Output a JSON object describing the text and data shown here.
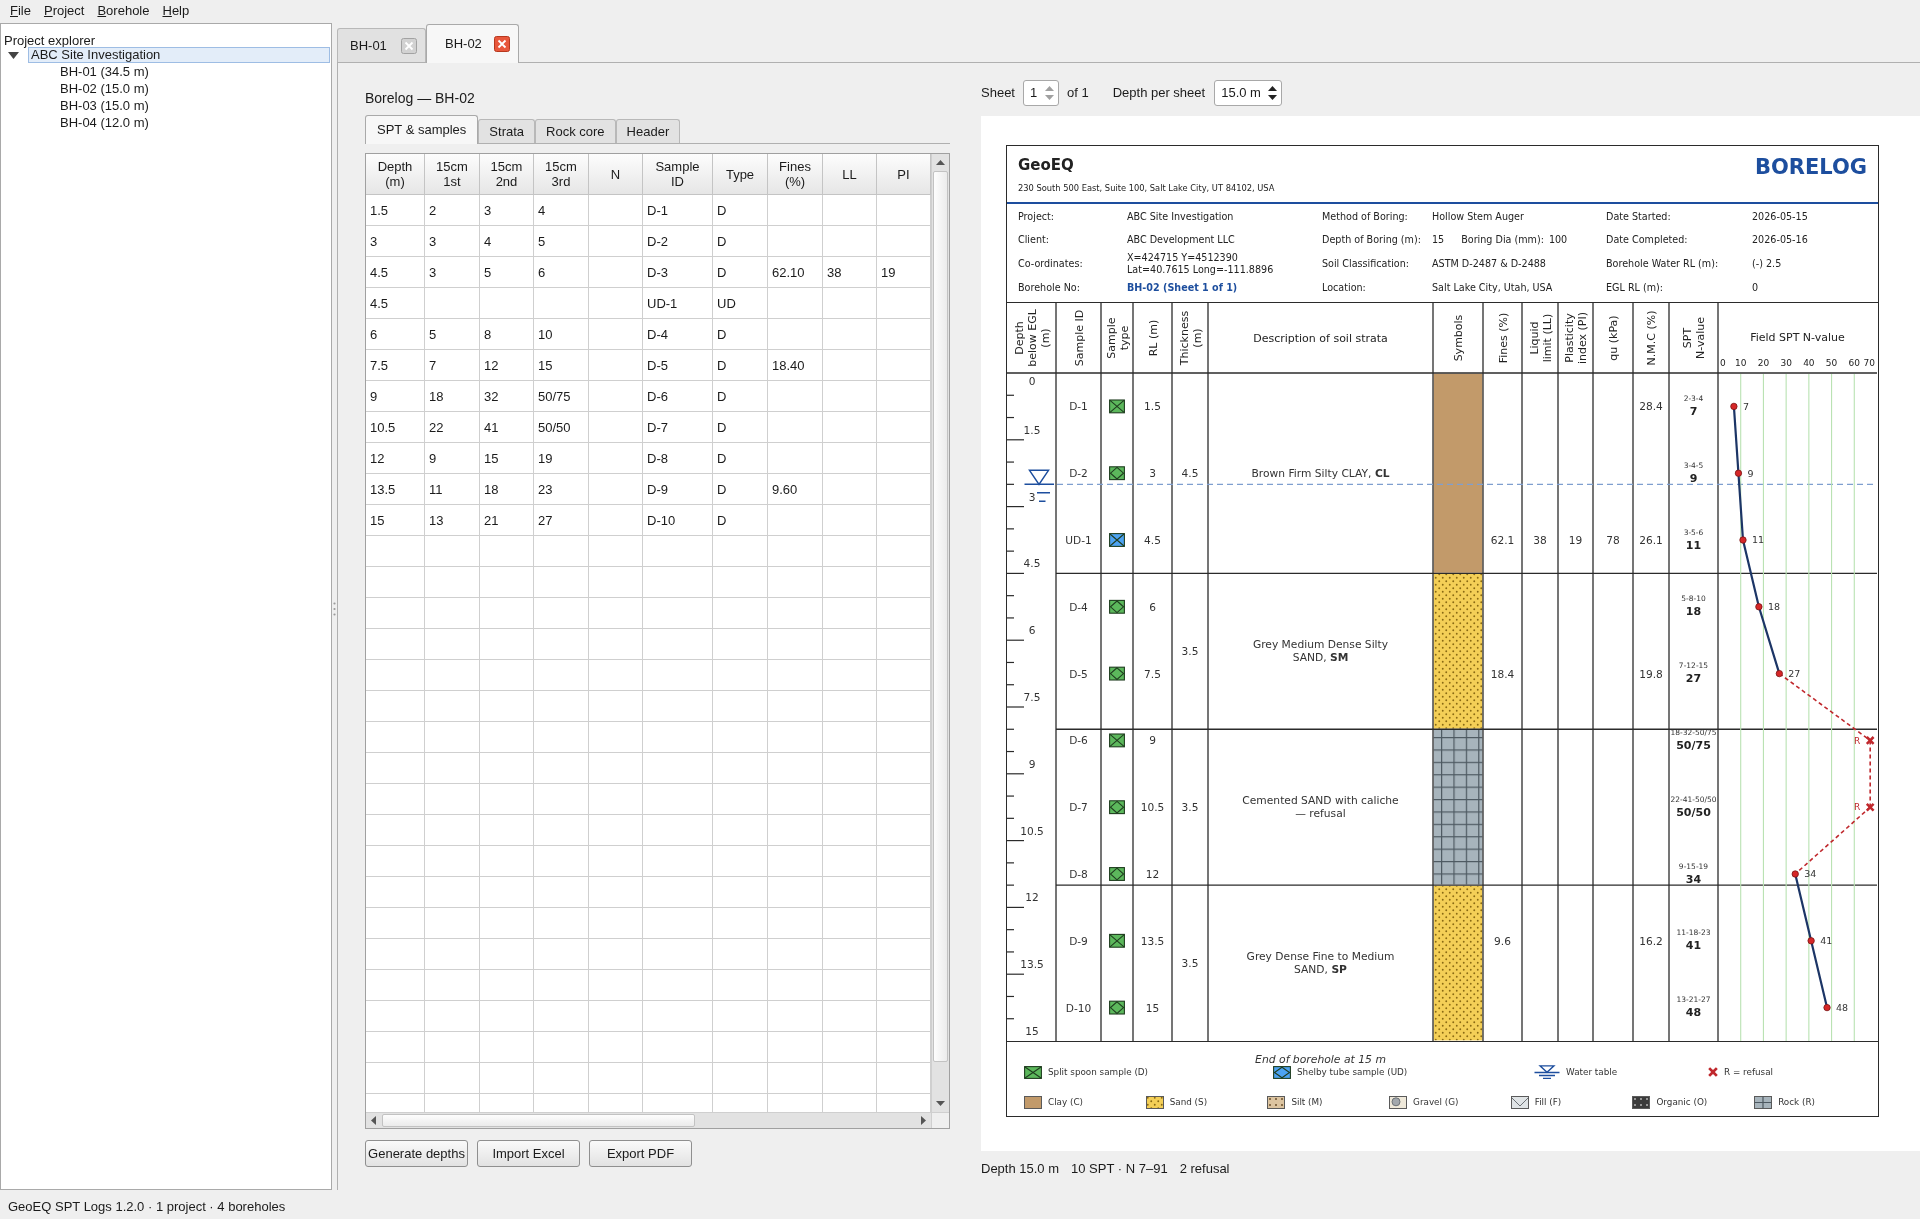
{
  "menu": [
    {
      "label": "File"
    },
    {
      "label": "Project"
    },
    {
      "label": "Borehole"
    },
    {
      "label": "Help"
    }
  ],
  "explorer": {
    "title": "Project explorer",
    "tree": [
      {
        "label": "ABC Site Investigation",
        "expanded": true,
        "selected": true,
        "children": [
          {
            "label": "BH-01 (34.5 m)",
            "selected": false
          },
          {
            "label": "BH-02 (15.0 m)",
            "selected": false
          },
          {
            "label": "BH-03 (15.0 m)",
            "selected": false
          },
          {
            "label": "BH-04 (12.0 m)",
            "selected": false
          }
        ]
      }
    ]
  },
  "doc_tabs": [
    {
      "label": "BH-01",
      "selected": false
    },
    {
      "label": "BH-02",
      "selected": true
    }
  ],
  "editor": {
    "title": "Borelog — BH-02",
    "tabs": [
      {
        "label": "SPT & samples",
        "selected": true
      },
      {
        "label": "Strata",
        "selected": false
      },
      {
        "label": "Rock core",
        "selected": false
      },
      {
        "label": "Header",
        "selected": false
      }
    ],
    "table": {
      "columns": [
        "Depth (m)",
        "15cm 1st",
        "15cm 2nd",
        "15cm 3rd",
        "N",
        "Sample ID",
        "Type",
        "Fines (%)",
        "LL",
        "PI"
      ],
      "rows": [
        [
          "1.5",
          "2",
          "3",
          "4",
          null,
          "D-1",
          "D",
          null,
          null,
          null
        ],
        [
          "3",
          "3",
          "4",
          "5",
          null,
          "D-2",
          "D",
          null,
          null,
          null
        ],
        [
          "4.5",
          "3",
          "5",
          "6",
          null,
          "D-3",
          "D",
          "62.10",
          "38",
          "19"
        ],
        [
          "4.5",
          null,
          null,
          null,
          null,
          "UD-1",
          "UD",
          null,
          null,
          null
        ],
        [
          "6",
          "5",
          "8",
          "10",
          null,
          "D-4",
          "D",
          null,
          null,
          null
        ],
        [
          "7.5",
          "7",
          "12",
          "15",
          null,
          "D-5",
          "D",
          "18.40",
          null,
          null
        ],
        [
          "9",
          "18",
          "32",
          "50/75",
          null,
          "D-6",
          "D",
          null,
          null,
          null
        ],
        [
          "10.5",
          "22",
          "41",
          "50/50",
          null,
          "D-7",
          "D",
          null,
          null,
          null
        ],
        [
          "12",
          "9",
          "15",
          "19",
          null,
          "D-8",
          "D",
          null,
          null,
          null
        ],
        [
          "13.5",
          "11",
          "18",
          "23",
          null,
          "D-9",
          "D",
          "9.60",
          null,
          null
        ],
        [
          "15",
          "13",
          "21",
          "27",
          null,
          "D-10",
          "D",
          null,
          null,
          null
        ]
      ]
    },
    "buttons": [
      {
        "label": "Generate depths"
      },
      {
        "label": "Import Excel"
      },
      {
        "label": "Export PDF"
      }
    ]
  },
  "preview": {
    "sheet": {
      "label": "Sheet",
      "value": "1",
      "suffix": "of 1",
      "steppers_enabled": false
    },
    "depth_per_sheet": {
      "label": "Depth per sheet",
      "value": "15.0 m",
      "steppers_enabled": true
    },
    "borelog": {
      "company": "GeoEQ",
      "address": "230 South 500 East, Suite 100, Salt Lake City, UT 84102, USA",
      "title": "BORELOG",
      "info": [
        {
          "label": "Project:",
          "value": "ABC Site Investigation",
          "kind": "plain"
        },
        {
          "label": "Method of Boring:",
          "value": "Hollow Stem Auger",
          "kind": "plain"
        },
        {
          "label": "Date Started:",
          "value": "2026-05-15",
          "kind": "plain"
        },
        {
          "label": "Client:",
          "value": "ABC Development LLC",
          "kind": "plain"
        },
        {
          "label": "Depth of Boring (m):",
          "value": "15",
          "kind": "plain",
          "extra_label": "Boring Dia (mm):",
          "extra_value": "100"
        },
        {
          "label": "Date Completed:",
          "value": "2026-05-16",
          "kind": "plain"
        },
        {
          "label": "Co-ordinates:",
          "value": "X=424715 Y=4512390\nLat=40.7615 Long=-111.8896",
          "kind": "plain"
        },
        {
          "label": "Soil Classification:",
          "value": "ASTM D-2487 & D-2488",
          "kind": "plain"
        },
        {
          "label": "Borehole Water RL (m):",
          "value": "(-) 2.5",
          "kind": "water"
        },
        {
          "label": "Borehole No:",
          "value": "BH-02 (Sheet 1 of 1)",
          "kind": "link"
        },
        {
          "label": "Location:",
          "value": "Salt Lake City, Utah, USA",
          "kind": "plain"
        },
        {
          "label": "EGL RL (m):",
          "value": "0",
          "kind": "plain"
        }
      ],
      "columns": [
        {
          "label": "Depth\nbelow EGL\n(m)",
          "kind": "rotated"
        },
        {
          "label": "Sample ID",
          "kind": "rotated"
        },
        {
          "label": "Sample\ntype",
          "kind": "rotated"
        },
        {
          "label": "RL (m)",
          "kind": "rotated"
        },
        {
          "label": "Thickness\n(m)",
          "kind": "rotated"
        },
        {
          "label": "Description of soil strata",
          "kind": "flat"
        },
        {
          "label": "Symbols",
          "kind": "rotated"
        },
        {
          "label": "Fines (%)",
          "kind": "rotated"
        },
        {
          "label": "Liquid\nlimit (LL)",
          "kind": "rotated"
        },
        {
          "label": "Plasticity\nindex (PI)",
          "kind": "rotated"
        },
        {
          "label": "qu (kPa)",
          "kind": "rotated"
        },
        {
          "label": "N.M.C (%)",
          "kind": "rotated"
        },
        {
          "label": "SPT\nN-value",
          "kind": "rotated"
        }
      ],
      "depth_labels": [
        "0",
        "1.5",
        "3",
        "4.5",
        "6",
        "7.5",
        "9",
        "10.5",
        "12",
        "13.5",
        "15"
      ],
      "layers": [
        {
          "description": "Brown Firm Silty CLAY, **CL**",
          "thickness": "4.5",
          "kind": "clay"
        },
        {
          "description": "Grey Medium Dense Silty SAND, **SM**",
          "thickness": "3.5",
          "kind": "sand"
        },
        {
          "description": "Cemented SAND with caliche — refusal",
          "thickness": "3.5",
          "kind": "rock"
        },
        {
          "description": "Grey Dense Fine to Medium SAND, **SP**",
          "thickness": "3.5",
          "kind": "sand"
        }
      ],
      "samples": [
        {
          "id": "D-1",
          "kind": "cross",
          "color": "#5cb85c",
          "rl": "1.5",
          "nmc": "28.4",
          "blows": "2-3-4",
          "n": "7"
        },
        {
          "id": "D-2",
          "kind": "diamond",
          "color": "#5cb85c",
          "rl": "3",
          "blows": "3-4-5",
          "n": "9"
        },
        {
          "id": "UD-1",
          "kind": "cross",
          "color": "#4da3f2",
          "rl": "4.5",
          "fines": "62.1",
          "ll": "38",
          "pi": "19",
          "qu": "78",
          "nmc": "26.1",
          "blows": "3-5-6",
          "n": "11"
        },
        {
          "id": "D-4",
          "kind": "diamond",
          "color": "#5cb85c",
          "rl": "6",
          "blows": "5-8-10",
          "n": "18"
        },
        {
          "id": "D-5",
          "kind": "diamond",
          "color": "#5cb85c",
          "rl": "7.5",
          "fines": "18.4",
          "nmc": "19.8",
          "blows": "7-12-15",
          "n": "27"
        },
        {
          "id": "D-6",
          "kind": "cross",
          "color": "#5cb85c",
          "rl": "9",
          "blows": "18-32-50/75",
          "n": "50/75"
        },
        {
          "id": "D-7",
          "kind": "diamond",
          "color": "#5cb85c",
          "rl": "10.5",
          "blows": "22-41-50/50",
          "n": "50/50"
        },
        {
          "id": "D-8",
          "kind": "diamond",
          "color": "#5cb85c",
          "rl": "12",
          "blows": "9-15-19",
          "n": "34"
        },
        {
          "id": "D-9",
          "kind": "cross",
          "color": "#5cb85c",
          "rl": "13.5",
          "fines": "9.6",
          "nmc": "16.2",
          "blows": "11-18-23",
          "n": "41"
        },
        {
          "id": "D-10",
          "kind": "diamond",
          "color": "#5cb85c",
          "rl": "15",
          "blows": "13-21-27",
          "n": "48"
        }
      ],
      "chart_data": {
        "type": "line",
        "title": "Field SPT N-value",
        "orientation": "horizontal",
        "grid": true,
        "categories": [
          null,
          null,
          null,
          null,
          null,
          null,
          null,
          null,
          null,
          null
        ],
        "xlim": [
          0,
          70
        ],
        "xticks": [
          0,
          10,
          20,
          30,
          40,
          50,
          60,
          70
        ],
        "series": [
          {
            "color": "#1c3566",
            "marker": "circle",
            "values": [
              7,
              9,
              11,
              18,
              27,
              null,
              null,
              34,
              41,
              48
            ],
            "value_labels": [
              "7",
              "9",
              "11",
              "18",
              "27",
              null,
              null,
              "34",
              "41",
              "48"
            ]
          },
          {
            "color": "#c0282d",
            "line_style": "dashed",
            "values": [
              null,
              null,
              null,
              null,
              27,
              67,
              null,
              null,
              null,
              null
            ]
          },
          {
            "color": "#c0282d",
            "line_style": "dashed",
            "marker": "cross",
            "values": [
              null,
              null,
              null,
              null,
              null,
              67,
              67,
              null,
              null,
              null
            ],
            "value_labels": [
              null,
              null,
              null,
              null,
              null,
              "R",
              "R",
              null,
              null,
              null
            ]
          },
          {
            "color": "#c0282d",
            "line_style": "dashed",
            "values": [
              null,
              null,
              null,
              null,
              null,
              null,
              67,
              34,
              null,
              null
            ]
          }
        ]
      },
      "legend": {
        "note": "End of borehole at 15 m",
        "symbols": [
          {
            "label": "Split spoon sample (D)",
            "kind": "cross",
            "color": "#5cb85c"
          },
          {
            "label": "Shelby tube sample (UD)",
            "kind": "diamond",
            "color": "#4da3f2"
          },
          {
            "label": "Water table",
            "kind": "water"
          },
          {
            "label": "R = refusal",
            "kind": "refusal"
          }
        ],
        "soils": [
          {
            "label": "Clay (C)",
            "kind": "clay"
          },
          {
            "label": "Sand (S)",
            "kind": "sand"
          },
          {
            "label": "Silt (M)",
            "kind": "silt"
          },
          {
            "label": "Gravel (G)",
            "kind": "gravel"
          },
          {
            "label": "Fill (F)",
            "kind": "fill"
          },
          {
            "label": "Organic (O)",
            "kind": "organic"
          },
          {
            "label": "Rock (R)",
            "kind": "rock"
          }
        ]
      }
    },
    "summary": [
      "Depth 15.0 m",
      "10 SPT · N 7–91",
      "2 refusal"
    ]
  },
  "status_bar": "GeoEQ SPT Logs 1.2.0 · 1 project · 4 boreholes"
}
